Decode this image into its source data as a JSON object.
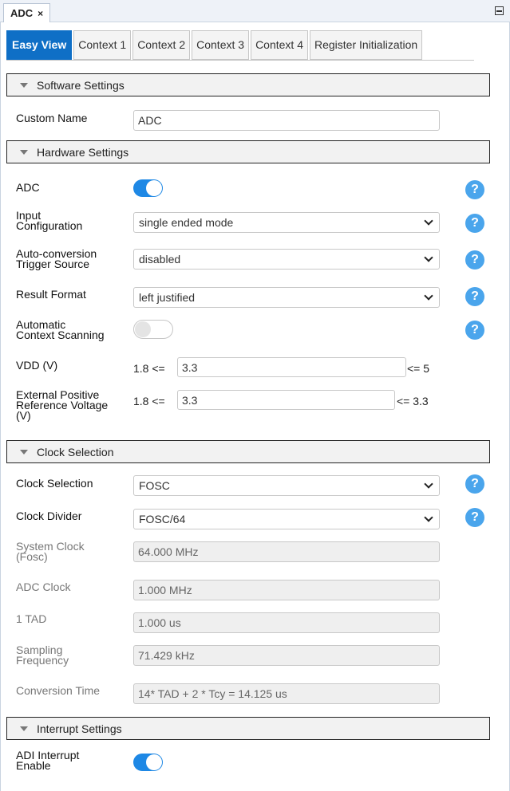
{
  "window": {
    "tab_title": "ADC",
    "close_glyph": "×"
  },
  "tabs": [
    {
      "label": "Easy View",
      "active": true
    },
    {
      "label": "Context 1"
    },
    {
      "label": "Context 2"
    },
    {
      "label": "Context 3"
    },
    {
      "label": "Context 4"
    },
    {
      "label": "Register Initialization"
    }
  ],
  "sections": {
    "software": "Software Settings",
    "hardware": "Hardware Settings",
    "clock": "Clock Selection",
    "interrupt": "Interrupt Settings"
  },
  "software": {
    "custom_name_label": "Custom Name",
    "custom_name_value": "ADC"
  },
  "hardware": {
    "adc_label": "ADC",
    "adc_enabled": true,
    "input_config_label_1": "Input",
    "input_config_label_2": "Configuration",
    "input_config_value": "single ended mode",
    "trigger_label_1": "Auto-conversion",
    "trigger_label_2": "Trigger Source",
    "trigger_value": "disabled",
    "result_format_label": "Result Format",
    "result_format_value": "left justified",
    "auto_scan_label_1": "Automatic",
    "auto_scan_label_2": "Context Scanning",
    "auto_scan_enabled": false,
    "vdd_label": "VDD (V)",
    "vdd_min": "1.8 <=",
    "vdd_value": "3.3",
    "vdd_max": "<= 5",
    "ref_label_1": "External Positive",
    "ref_label_2": "Reference Voltage",
    "ref_label_3": "(V)",
    "ref_min": "1.8 <=",
    "ref_value": "3.3",
    "ref_max": "<= 3.3"
  },
  "clock": {
    "selection_label": "Clock Selection",
    "selection_value": "FOSC",
    "divider_label": "Clock Divider",
    "divider_value": "FOSC/64",
    "system_clock_label_1": "System Clock",
    "system_clock_label_2": "(Fosc)",
    "system_clock_value": "64.000 MHz",
    "adc_clock_label": "ADC Clock",
    "adc_clock_value": "1.000 MHz",
    "tad_label": "1 TAD",
    "tad_value": "1.000 us",
    "sampling_label_1": "Sampling",
    "sampling_label_2": "Frequency",
    "sampling_value": "71.429 kHz",
    "conversion_label": "Conversion Time",
    "conversion_value": "14* TAD + 2 * Tcy = 14.125 us"
  },
  "interrupt": {
    "adi_label_1": "ADI Interrupt",
    "adi_label_2": "Enable",
    "adi_enabled": true
  },
  "help_glyph": "?",
  "colors": {
    "accent": "#0f6fc6",
    "toggle_on": "#1e88e5",
    "help": "#4aa5ec"
  }
}
